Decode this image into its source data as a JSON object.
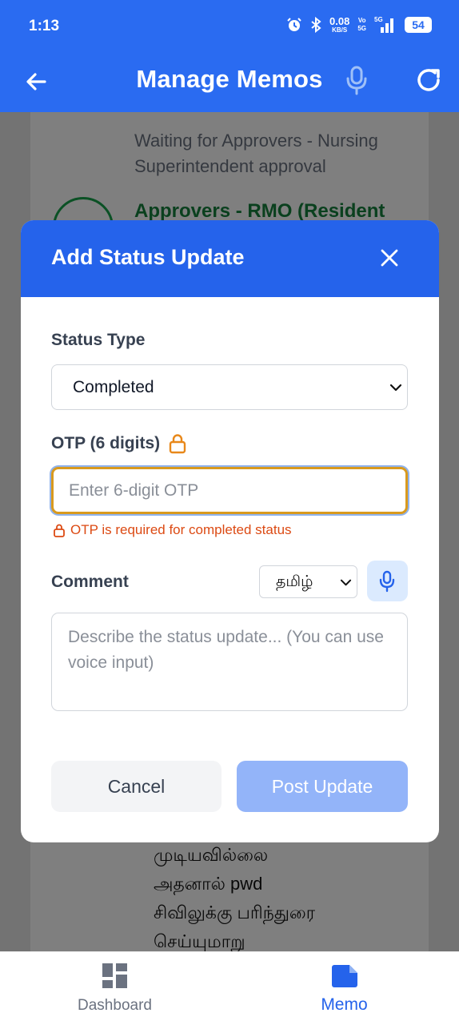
{
  "status_bar": {
    "time": "1:13",
    "net_speed_top": "0.08",
    "net_speed_bottom": "KB/S",
    "volte_top": "Vo",
    "volte_bottom": "5G",
    "signal_label": "5G",
    "battery": "54"
  },
  "app_bar": {
    "title": "Manage Memos",
    "back_icon": "arrow-left-icon",
    "mic_icon": "microphone-icon",
    "refresh_icon": "refresh-icon"
  },
  "background": {
    "waiting_text": "Waiting for Approvers - Nursing Superintendent approval",
    "approvers_text": "Approvers - RMO (Resident",
    "tamil_lines": "முடியவில்லை\nஅதனால் pwd\nசிவிலுக்கு பரிந்துரை\nசெய்யுமாறு"
  },
  "modal": {
    "title": "Add Status Update",
    "close_icon": "close-icon",
    "status_type_label": "Status Type",
    "status_type_value": "Completed",
    "otp_label": "OTP (6 digits)",
    "otp_placeholder": "Enter 6-digit OTP",
    "otp_error": "OTP is required for completed status",
    "comment_label": "Comment",
    "language_value": "தமிழ்",
    "comment_placeholder": "Describe the status update... (You can use voice input)",
    "cancel_label": "Cancel",
    "post_label": "Post Update"
  },
  "bottom_nav": {
    "items": [
      {
        "label": "Dashboard",
        "icon": "dashboard-icon",
        "active": false
      },
      {
        "label": "Memo",
        "icon": "memo-icon",
        "active": true
      }
    ]
  },
  "colors": {
    "primary": "#2563eb",
    "app_bar": "#2a6bf1",
    "warning": "#d99a1e",
    "error": "#dc4a13",
    "post_disabled": "#93b4f9"
  }
}
